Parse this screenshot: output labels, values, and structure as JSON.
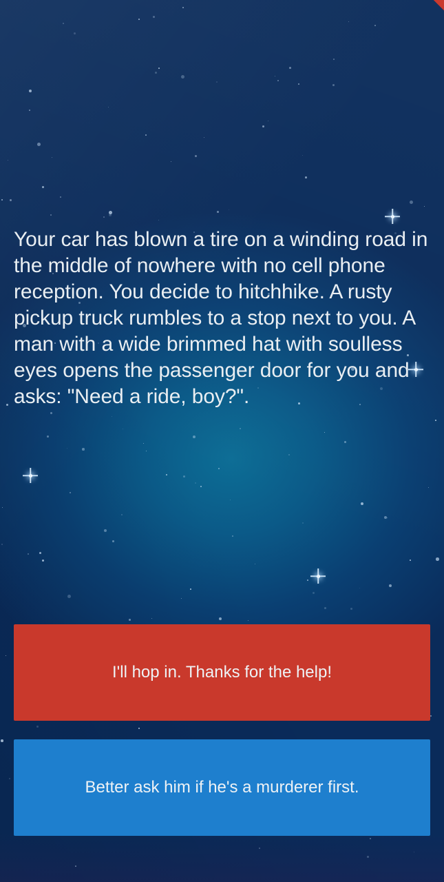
{
  "story": {
    "text": "Your car has blown a tire on a winding road in the middle of nowhere with no cell phone reception. You decide to hitchhike. A rusty pickup truck rumbles to a stop next to you. A man with a wide brimmed hat with soulless eyes opens the passenger door for you and asks: \"Need a ride, boy?\"."
  },
  "choices": [
    {
      "label": "I'll hop in. Thanks for the help!",
      "color": "#c9392c"
    },
    {
      "label": "Better ask him if he's a murderer first.",
      "color": "#1e7fce"
    }
  ],
  "theme": {
    "background": "#0a3f72",
    "text_color": "#e9eef2"
  }
}
